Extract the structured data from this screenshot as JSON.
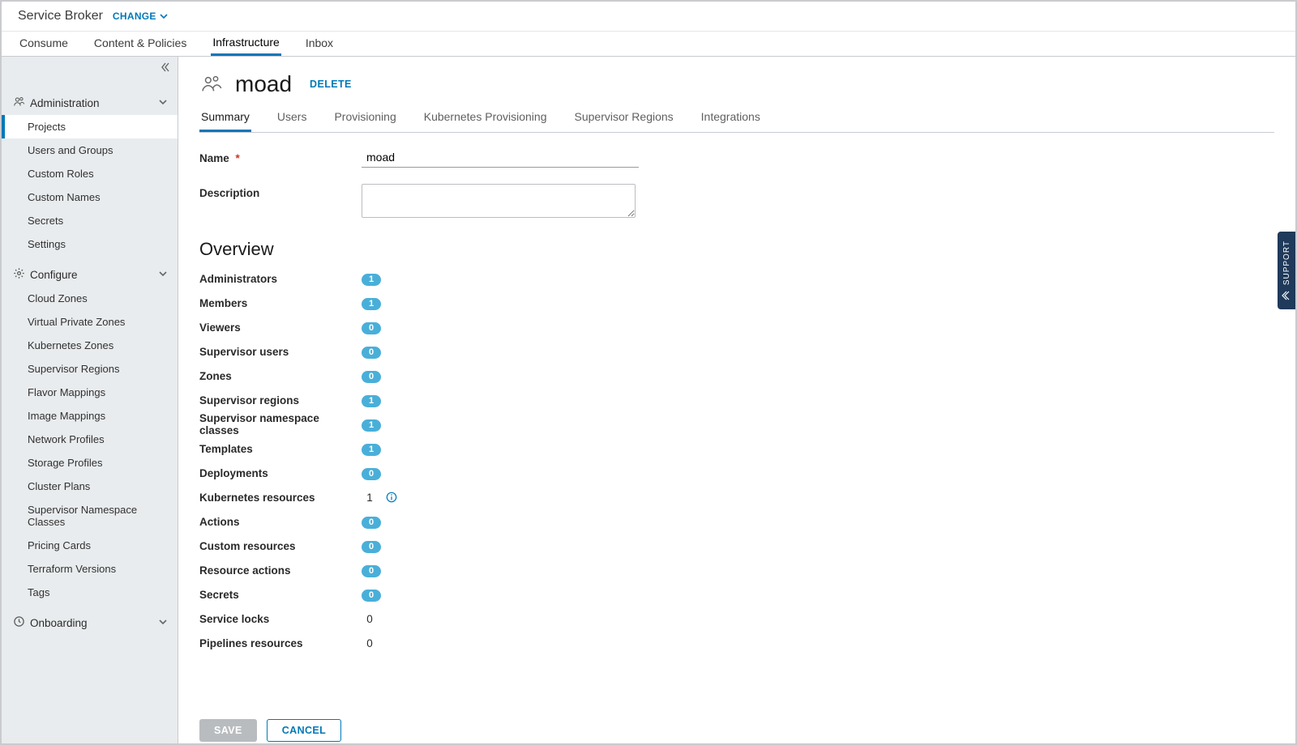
{
  "topbar": {
    "product": "Service Broker",
    "change_label": "CHANGE"
  },
  "primary_tabs": {
    "items": [
      "Consume",
      "Content & Policies",
      "Infrastructure",
      "Inbox"
    ],
    "active_index": 2
  },
  "sidebar": {
    "sections": [
      {
        "title": "Administration",
        "icon": "admin",
        "items": [
          "Projects",
          "Users and Groups",
          "Custom Roles",
          "Custom Names",
          "Secrets",
          "Settings"
        ],
        "active_item_index": 0
      },
      {
        "title": "Configure",
        "icon": "gear",
        "items": [
          "Cloud Zones",
          "Virtual Private Zones",
          "Kubernetes Zones",
          "Supervisor Regions",
          "Flavor Mappings",
          "Image Mappings",
          "Network Profiles",
          "Storage Profiles",
          "Cluster Plans",
          "Supervisor Namespace Classes",
          "Pricing Cards",
          "Terraform Versions",
          "Tags"
        ],
        "active_item_index": -1
      },
      {
        "title": "Onboarding",
        "icon": "clock",
        "items": [],
        "active_item_index": -1
      }
    ]
  },
  "page": {
    "title": "moad",
    "delete_label": "DELETE"
  },
  "detail_tabs": {
    "items": [
      "Summary",
      "Users",
      "Provisioning",
      "Kubernetes Provisioning",
      "Supervisor Regions",
      "Integrations"
    ],
    "active_index": 0
  },
  "form": {
    "name_label": "Name",
    "name_value": "moad",
    "name_required": true,
    "desc_label": "Description",
    "desc_value": ""
  },
  "overview": {
    "heading": "Overview",
    "rows": [
      {
        "label": "Administrators",
        "value": "1",
        "badge": true,
        "info": false
      },
      {
        "label": "Members",
        "value": "1",
        "badge": true,
        "info": false
      },
      {
        "label": "Viewers",
        "value": "0",
        "badge": true,
        "info": false
      },
      {
        "label": "Supervisor users",
        "value": "0",
        "badge": true,
        "info": false
      },
      {
        "label": "Zones",
        "value": "0",
        "badge": true,
        "info": false
      },
      {
        "label": "Supervisor regions",
        "value": "1",
        "badge": true,
        "info": false
      },
      {
        "label": "Supervisor namespace classes",
        "value": "1",
        "badge": true,
        "info": false
      },
      {
        "label": "Templates",
        "value": "1",
        "badge": true,
        "info": false
      },
      {
        "label": "Deployments",
        "value": "0",
        "badge": true,
        "info": false
      },
      {
        "label": "Kubernetes resources",
        "value": "1",
        "badge": false,
        "info": true
      },
      {
        "label": "Actions",
        "value": "0",
        "badge": true,
        "info": false
      },
      {
        "label": "Custom resources",
        "value": "0",
        "badge": true,
        "info": false
      },
      {
        "label": "Resource actions",
        "value": "0",
        "badge": true,
        "info": false
      },
      {
        "label": "Secrets",
        "value": "0",
        "badge": true,
        "info": false
      },
      {
        "label": "Service locks",
        "value": "0",
        "badge": false,
        "info": false
      },
      {
        "label": "Pipelines resources",
        "value": "0",
        "badge": false,
        "info": false
      }
    ]
  },
  "footer": {
    "save_label": "SAVE",
    "cancel_label": "CANCEL"
  },
  "support_label": "SUPPORT"
}
